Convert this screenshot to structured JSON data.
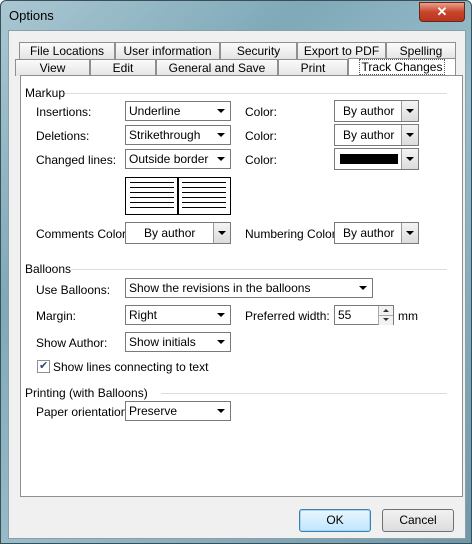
{
  "window": {
    "title": "Options",
    "close_glyph": "✕"
  },
  "tabs_row1": [
    "File Locations",
    "User information",
    "Security",
    "Export to PDF",
    "Spelling"
  ],
  "tabs_row2": [
    "View",
    "Edit",
    "General and Save",
    "Print",
    "Track Changes"
  ],
  "markup": {
    "header": "Markup",
    "insertions_label": "Insertions:",
    "insertions_value": "Underline",
    "deletions_label": "Deletions:",
    "deletions_value": "Strikethrough",
    "changed_label": "Changed lines:",
    "changed_value": "Outside border",
    "color_label": "Color:",
    "insertions_color": "By author",
    "deletions_color": "By author",
    "changed_color_hex": "#000000",
    "comments_color_label": "Comments Color:",
    "comments_color_value": "By author",
    "numbering_color_label": "Numbering Color:",
    "numbering_color_value": "By author"
  },
  "balloons": {
    "header": "Balloons",
    "use_label": "Use Balloons:",
    "use_value": "Show the revisions in the balloons",
    "margin_label": "Margin:",
    "margin_value": "Right",
    "pref_width_label": "Preferred width:",
    "pref_width_value": "55",
    "pref_width_unit": "mm",
    "show_author_label": "Show Author:",
    "show_author_value": "Show initials",
    "show_lines_label": "Show lines connecting to text",
    "show_lines_checked": true
  },
  "printing": {
    "header": "Printing (with Balloons)",
    "orientation_label": "Paper orientation:",
    "orientation_value": "Preserve"
  },
  "buttons": {
    "ok": "OK",
    "cancel": "Cancel"
  }
}
